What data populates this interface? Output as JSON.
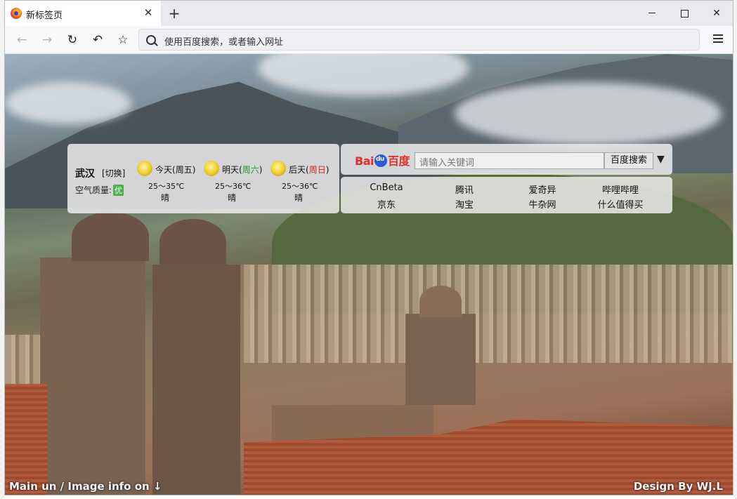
{
  "browser": {
    "tab_title": "新标签页",
    "tab_close": "✕",
    "new_tab": "+",
    "url_placeholder": "使用百度搜索，或者输入网址"
  },
  "weather": {
    "city": "武汉",
    "switch_label": "[切换]",
    "air_quality_label": "空气质量:",
    "air_quality_value": "优",
    "days": [
      {
        "name": "今天",
        "weekday": "周五",
        "temp": "25～35℃",
        "cond": "晴"
      },
      {
        "name": "明天",
        "weekday": "周六",
        "temp": "25～36℃",
        "cond": "晴"
      },
      {
        "name": "后天",
        "weekday": "周日",
        "temp": "25～36℃",
        "cond": "晴"
      }
    ]
  },
  "search": {
    "logo_left": "Bai",
    "logo_right": "百度",
    "placeholder": "请输入关键词",
    "button": "百度搜索",
    "dropdown": "▼"
  },
  "links": {
    "row1": [
      "CnBeta",
      "腾讯",
      "爱奇异",
      "哔哩哔哩"
    ],
    "row2": [
      "京东",
      "淘宝",
      "牛杂网",
      "什么值得买"
    ]
  },
  "footer": {
    "left": "Main un / Image info on ↓",
    "right": "Design By WJ.L"
  },
  "colors": {
    "baidu_red": "#e32c2c",
    "baidu_blue": "#2a5ad6",
    "weekday_green": "#2e8b2e",
    "weekday_red": "#d02020"
  }
}
